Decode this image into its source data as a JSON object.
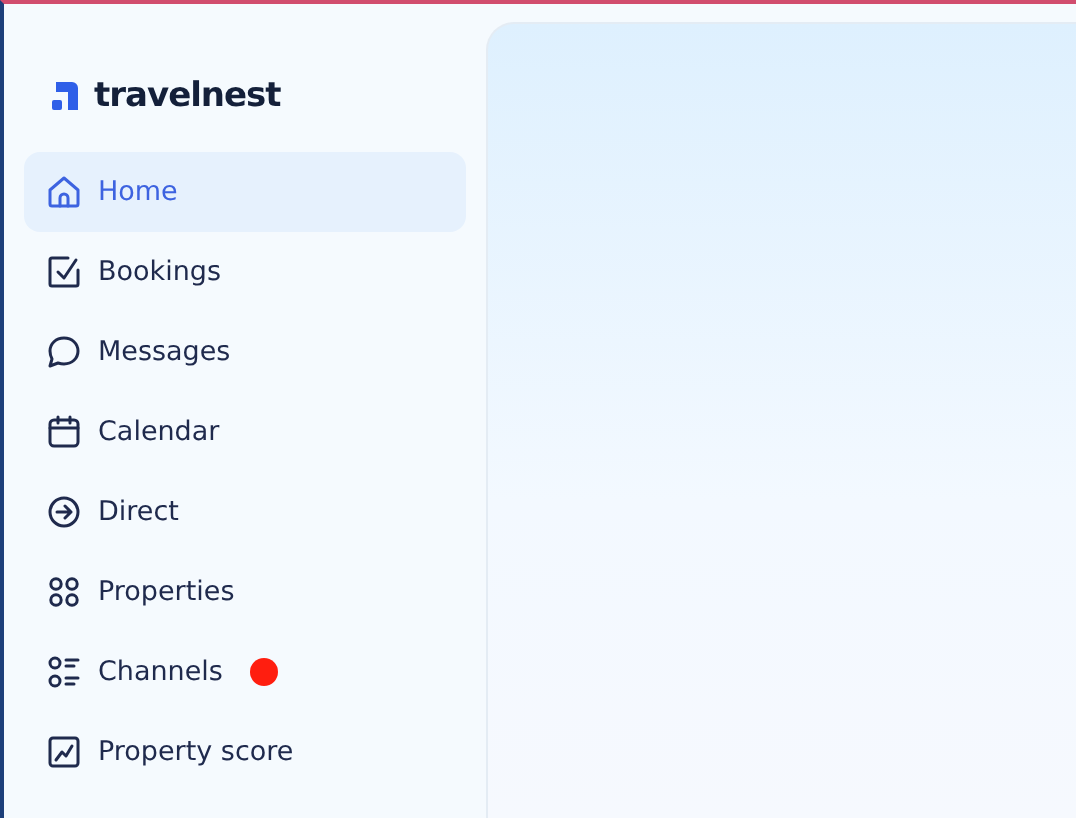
{
  "logo": {
    "text": "travelnest"
  },
  "sidebar": {
    "items": [
      {
        "label": "Home",
        "kind": "home",
        "selected": true
      },
      {
        "label": "Bookings",
        "kind": "bookings",
        "selected": false
      },
      {
        "label": "Messages",
        "kind": "messages",
        "selected": false
      },
      {
        "label": "Calendar",
        "kind": "calendar",
        "selected": false
      },
      {
        "label": "Direct",
        "kind": "direct",
        "selected": false
      },
      {
        "label": "Properties",
        "kind": "properties",
        "selected": false
      },
      {
        "label": "Channels",
        "kind": "channels",
        "selected": false,
        "color": "#ff1e0f"
      },
      {
        "label": "Property score",
        "kind": "score",
        "selected": false
      }
    ]
  }
}
